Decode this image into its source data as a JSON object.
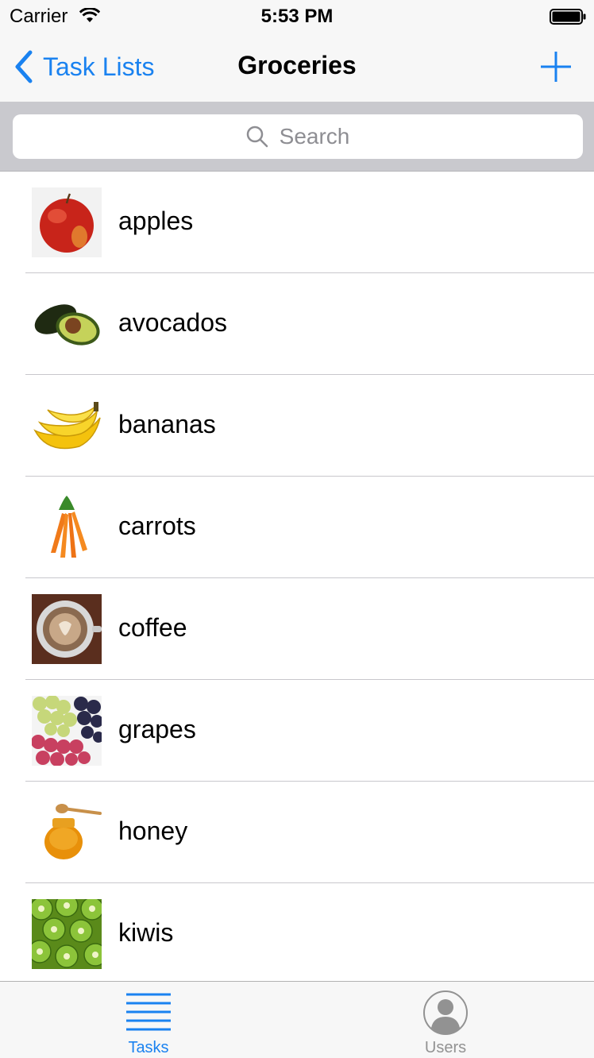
{
  "status_bar": {
    "carrier": "Carrier",
    "time": "5:53 PM"
  },
  "nav": {
    "back_label": "Task Lists",
    "title": "Groceries",
    "add_icon": "plus-icon",
    "accent_color": "#1a82f0"
  },
  "search": {
    "placeholder": "Search"
  },
  "items": [
    {
      "label": "apples",
      "icon": "apple-image"
    },
    {
      "label": "avocados",
      "icon": "avocado-image"
    },
    {
      "label": "bananas",
      "icon": "banana-image"
    },
    {
      "label": "carrots",
      "icon": "carrot-image"
    },
    {
      "label": "coffee",
      "icon": "coffee-image"
    },
    {
      "label": "grapes",
      "icon": "grapes-image"
    },
    {
      "label": "honey",
      "icon": "honey-image"
    },
    {
      "label": "kiwis",
      "icon": "kiwi-image"
    }
  ],
  "tab_bar": {
    "tabs": [
      {
        "label": "Tasks",
        "icon": "list-icon",
        "selected": true
      },
      {
        "label": "Users",
        "icon": "user-icon",
        "selected": false
      }
    ]
  }
}
